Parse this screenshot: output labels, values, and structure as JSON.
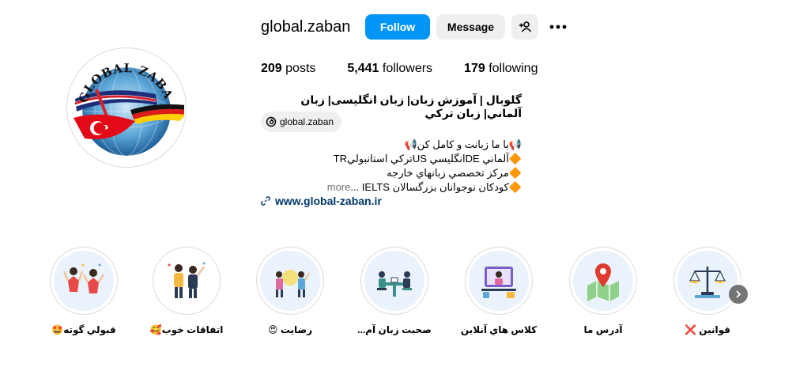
{
  "profile": {
    "username": "global.zaban",
    "follow_label": "Follow",
    "message_label": "Message",
    "add_user_icon": "add-user-icon",
    "more_icon": "more-options-icon",
    "logo_text": "GLOBAL ZABAN"
  },
  "stats": {
    "posts_count": "209",
    "posts_label": "posts",
    "followers_count": "5,441",
    "followers_label": "followers",
    "following_count": "179",
    "following_label": "following"
  },
  "bio": {
    "name": "گلوبال | آموزش زبان| زبان انگلیسی| زبان آلماني| زبان تركي",
    "threads_handle": "global.zaban",
    "line1": "📢با ما زبانت و کامل کن📢",
    "line2": "🔶آلماني DEانگليسي USتركي استانبوليTR",
    "line3": "🔶مرکز تخصصي زبانهاي خارجه",
    "line4": "🔶كودكان نوجوانان بزرگسالان IELTS ...",
    "more_label": "more",
    "website": "www.global-zaban.ir"
  },
  "highlights": [
    {
      "label": "قبولي گوته🤩",
      "icon": "celebrating-people-icon"
    },
    {
      "label": "اتفاقات خوب🥰",
      "icon": "group-celebration-icon"
    },
    {
      "label": "رضایت 😍",
      "icon": "satisfaction-people-icon"
    },
    {
      "label": "صحبت زبان آم...",
      "icon": "conversation-table-icon"
    },
    {
      "label": "كلاس هاي آنلاين",
      "icon": "online-class-icon"
    },
    {
      "label": "آدرس ما",
      "icon": "map-pin-icon"
    },
    {
      "label": "قوانين ❌",
      "icon": "scales-of-justice-icon"
    }
  ],
  "colors": {
    "follow_blue": "#0095f6",
    "button_gray": "#efefef",
    "link_blue": "#00376b",
    "highlight_bg": "#eaf3fc"
  }
}
